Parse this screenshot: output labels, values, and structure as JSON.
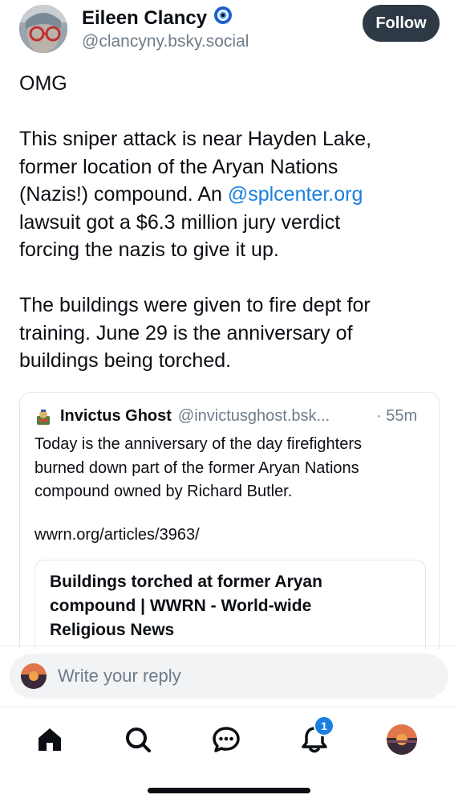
{
  "post": {
    "author_name": "Eileen Clancy",
    "author_handle": "@clancyny.bsky.social",
    "follow_label": "Follow",
    "paragraph1": "OMG",
    "paragraph2_lines": [
      "This sniper attack is near Hayden Lake,",
      "former location of the Aryan Nations",
      "(Nazis!) compound. An ",
      "lawsuit got a $6.3 million jury verdict",
      "forcing the nazis to give it up."
    ],
    "mention": "@splcenter.org",
    "paragraph3_lines": [
      "The buildings were given to fire dept for",
      "training. June 29 is the anniversary of",
      "buildings being torched."
    ]
  },
  "quote": {
    "author_name": "Invictus Ghost",
    "author_handle": "@invictusghost.bsk...",
    "time": "· 55m",
    "text_lines": [
      "Today is the anniversary of the day firefighters",
      "burned down part of the former Aryan Nations",
      "compound owned by Richard Butler."
    ],
    "link": "wwrn.org/articles/3963/",
    "embed_title_lines": [
      "Buildings torched at former Aryan",
      "compound | WWRN - World-wide",
      "Religious News"
    ]
  },
  "reply": {
    "placeholder": "Write your reply"
  },
  "nav": {
    "notifications_badge": "1",
    "icons": [
      "home-icon",
      "search-icon",
      "chat-icon",
      "bell-icon",
      "profile-avatar"
    ]
  },
  "colors": {
    "accent": "#1a7fe0",
    "follow_bg": "#2d3944",
    "muted": "#6f7c88"
  }
}
